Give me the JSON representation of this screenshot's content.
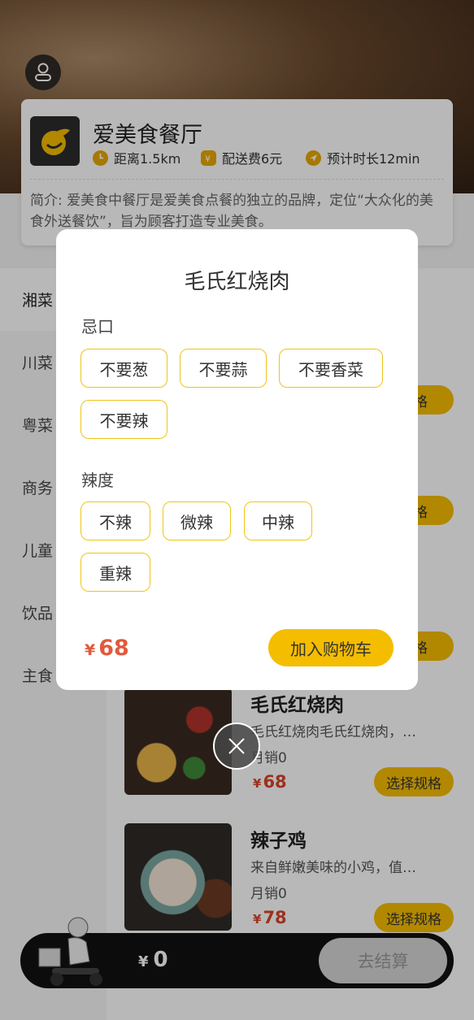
{
  "restaurant": {
    "name": "爱美食餐厅",
    "distance": "距离1.5km",
    "delivery_fee": "配送费6元",
    "eta": "预计时长12min",
    "intro": "简介: 爱美食中餐厅是爱美食点餐的独立的品牌，定位“大众化的美食外送餐饮”，旨为顾客打造专业美食。"
  },
  "categories": [
    "湘菜",
    "川菜",
    "粤菜",
    "商务",
    "儿童",
    "饮品",
    "主食"
  ],
  "products": [
    {
      "name": "",
      "desc": "…",
      "sales": "",
      "price": "",
      "spec_label": "规格"
    },
    {
      "name": "",
      "desc": "…",
      "sales": "",
      "price": "",
      "spec_label": "规格"
    },
    {
      "name": "",
      "desc": "…",
      "sales": "",
      "price": "",
      "spec_label": "规格"
    },
    {
      "name": "毛氏红烧肉",
      "desc": "毛氏红烧肉毛氏红烧肉，…",
      "sales": "月销0",
      "price": "68",
      "spec_label": "选择规格"
    },
    {
      "name": "辣子鸡",
      "desc": "来自鲜嫩美味的小鸡，值…",
      "sales": "月销0",
      "price": "78",
      "spec_label": "选择规格"
    }
  ],
  "currency": "¥",
  "cart": {
    "total": "0",
    "checkout_label": "去结算"
  },
  "modal": {
    "title": "毛氏红烧肉",
    "groups": [
      {
        "label": "忌口",
        "options": [
          "不要葱",
          "不要蒜",
          "不要香菜",
          "不要辣"
        ]
      },
      {
        "label": "辣度",
        "options": [
          "不辣",
          "微辣",
          "中辣",
          "重辣"
        ]
      }
    ],
    "price": "68",
    "add_label": "加入购物车"
  },
  "colors": {
    "accent": "#f5bd00",
    "price": "#d9452b",
    "tag_border": "#f0c419"
  },
  "icons": [
    "user-icon",
    "clock-icon",
    "money-bag-icon",
    "navigation-icon",
    "close-icon",
    "restaurant-logo-icon"
  ]
}
